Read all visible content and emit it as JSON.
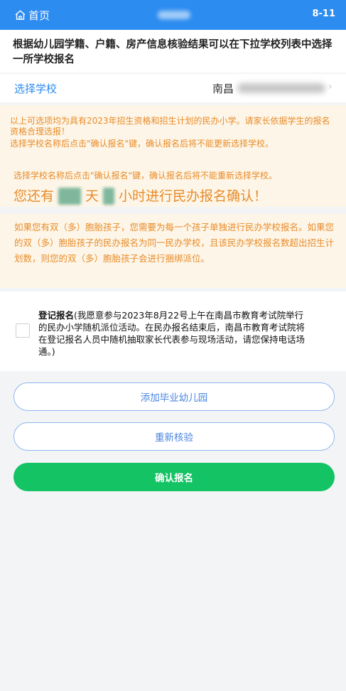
{
  "topbar": {
    "home_label": "首页",
    "date": "8-11"
  },
  "notice": {
    "text": "根据幼儿园学籍、户籍、房产信息核验结果可以在下拉学校列表中选择一所学校报名"
  },
  "school_select": {
    "label": "选择学校",
    "value": "南昌"
  },
  "warning": {
    "line1": "以上可选项均为具有2023年招生资格和招生计划的民办小学。请家长依据学生的报名资格合理选报！",
    "line2": "选择学校名称后点击\"确认报名\"键，确认报名后将不能更新选择学校。",
    "line3": "选择学校名称后点击\"确认报名\"键，确认报名后将不能重新选择学校。",
    "countdown_prefix": "您还有",
    "countdown_day_unit": "天",
    "countdown_suffix": "小时进行民办报名确认！"
  },
  "twins_notice": {
    "text": "如果您有双（多）胞胎孩子，您需要为每一个孩子单独进行民办学校报名。如果您的双（多）胞胎孩子的民办报名为同一民办学校，且该民办学校报名数超出招生计划数，则您的双（多）胞胎孩子会进行捆绑派位。"
  },
  "registration": {
    "title": "登记报名",
    "description": "(我愿意参与2023年8月22号上午在南昌市教育考试院举行的民办小学随机派位活动。在民办报名结束后，南昌市教育考试院将在登记报名人员中随机抽取家长代表参与现场活动，请您保持电话场通。)",
    "checked": false
  },
  "buttons": {
    "add_kindergarten": "添加毕业幼儿园",
    "recheck": "重新核验",
    "confirm": "确认报名"
  },
  "colors": {
    "primary": "#2d8cf0",
    "warning_text": "#e88b2a",
    "warning_bg": "#fdf6e8",
    "confirm_green": "#13c364"
  }
}
